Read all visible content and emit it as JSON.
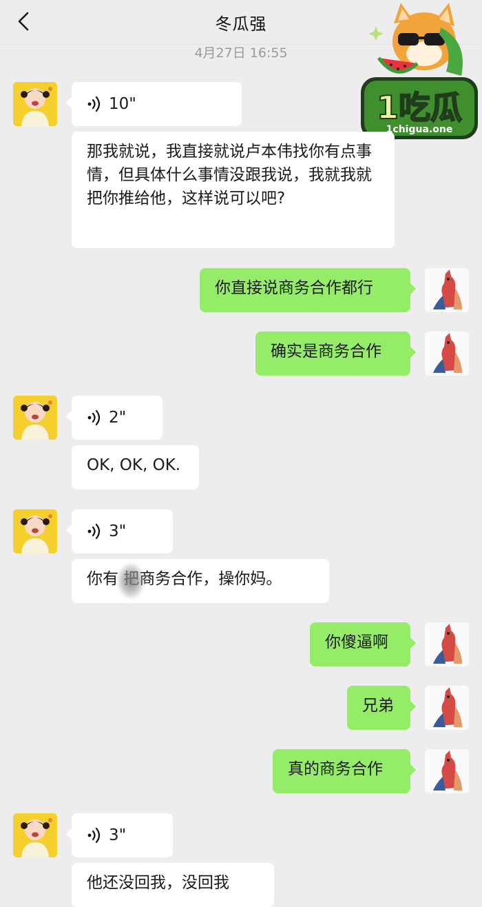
{
  "header": {
    "title": "冬瓜强",
    "timestamp": "4月27日 16:55"
  },
  "watermark": {
    "text": "1吃瓜",
    "site": "1chigua.one"
  },
  "messages": [
    {
      "side": "left",
      "type": "voice",
      "duration": "10\""
    },
    {
      "side": "left",
      "type": "text",
      "text": "那我就说，我直接就说卢本伟找你有点事情，但具体什么事情没跟我说，我就我就把你推给他，这样说可以吧?"
    },
    {
      "side": "right",
      "type": "text",
      "text": "你直接说商务合作都行"
    },
    {
      "side": "right",
      "type": "text",
      "text": "确实是商务合作"
    },
    {
      "side": "left",
      "type": "voice",
      "duration": "2\""
    },
    {
      "side": "left",
      "type": "text",
      "text": "OK, OK, OK."
    },
    {
      "side": "left",
      "type": "voice",
      "duration": "3\""
    },
    {
      "side": "left",
      "type": "text",
      "text": "你有 把商务合作，操你妈。"
    },
    {
      "side": "right",
      "type": "text",
      "text": "你傻逼啊"
    },
    {
      "side": "right",
      "type": "text",
      "text": "兄弟"
    },
    {
      "side": "right",
      "type": "text",
      "text": "真的商务合作"
    },
    {
      "side": "left",
      "type": "voice",
      "duration": "3\""
    },
    {
      "side": "left",
      "type": "text",
      "text": "他还没回我，没回我"
    }
  ]
}
